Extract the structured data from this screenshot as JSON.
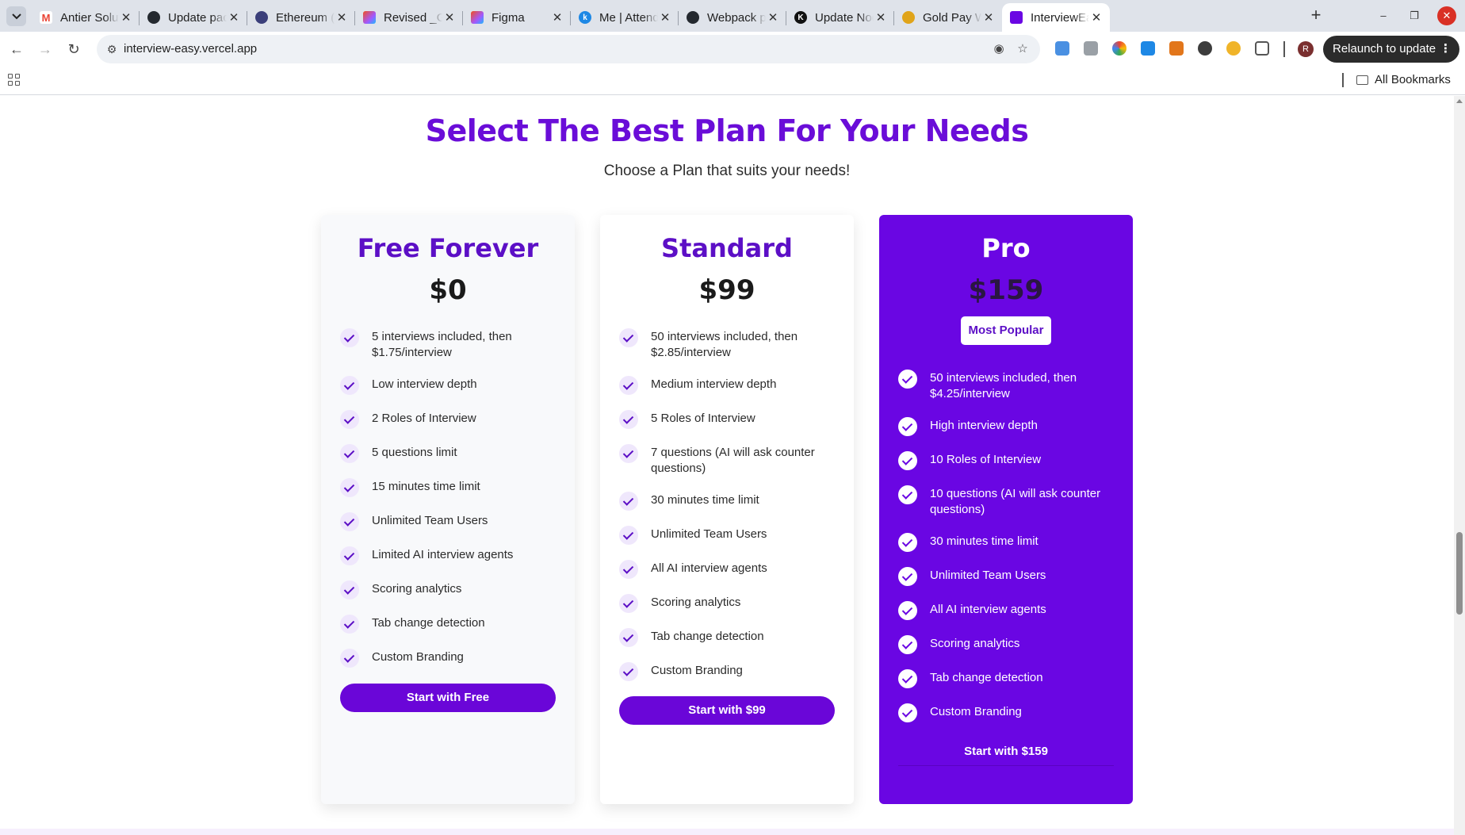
{
  "browser": {
    "tabs": [
      {
        "title": "Antier Solutions",
        "favicon": "gmail-icon",
        "color": "#ea4335"
      },
      {
        "title": "Update package",
        "favicon": "github-icon",
        "color": "#24292f"
      },
      {
        "title": "Ethereum (ETH)",
        "favicon": "moon-icon",
        "color": "#3b3f7a"
      },
      {
        "title": "Revised _Gold",
        "favicon": "figma-icon",
        "color": "#f24e1e"
      },
      {
        "title": "Figma",
        "favicon": "figma-icon",
        "color": "#a259ff"
      },
      {
        "title": "Me | Attendance",
        "favicon": "k-icon",
        "color": "#1e88e5"
      },
      {
        "title": "Webpack path",
        "favicon": "github-icon",
        "color": "#24292f"
      },
      {
        "title": "Update Node",
        "favicon": "k-icon",
        "color": "#111111"
      },
      {
        "title": "Gold Pay Wallet",
        "favicon": "goldpay-icon",
        "color": "#e0a41a"
      },
      {
        "title": "InterviewEasy",
        "favicon": "interview-icon",
        "color": "#6a06e3",
        "active": true
      }
    ],
    "url": "interview-easy.vercel.app",
    "relaunch_label": "Relaunch to update",
    "avatar_initial": "R",
    "bookmarks_label": "All Bookmarks"
  },
  "page": {
    "heading": "Select The Best Plan For Your Needs",
    "subheading": "Choose a Plan that suits your needs!",
    "plans": [
      {
        "name": "Free Forever",
        "price": "$0",
        "features": [
          "5 interviews included, then $1.75/interview",
          "Low interview depth",
          "2 Roles of Interview",
          "5 questions limit",
          "15 minutes time limit",
          "Unlimited Team Users",
          "Limited AI interview agents",
          "Scoring analytics",
          "Tab change detection",
          "Custom Branding"
        ],
        "cta": "Start with Free"
      },
      {
        "name": "Standard",
        "price": "$99",
        "features": [
          "50 interviews included, then $2.85/interview",
          "Medium interview depth",
          "5 Roles of Interview",
          "7 questions (AI will ask counter questions)",
          "30 minutes time limit",
          "Unlimited Team Users",
          "All AI interview agents",
          "Scoring analytics",
          "Tab change detection",
          "Custom Branding"
        ],
        "cta": "Start with $99"
      },
      {
        "name": "Pro",
        "price": "$159",
        "badge": "Most Popular",
        "features": [
          "50 interviews included, then $4.25/interview",
          "High interview depth",
          "10 Roles of Interview",
          "10 questions (AI will ask counter questions)",
          "30 minutes time limit",
          "Unlimited Team Users",
          "All AI interview agents",
          "Scoring analytics",
          "Tab change detection",
          "Custom Branding"
        ],
        "cta": "Start with $159"
      }
    ]
  },
  "colors": {
    "accent": "#6a06e3",
    "heading": "#6a0dd8"
  }
}
